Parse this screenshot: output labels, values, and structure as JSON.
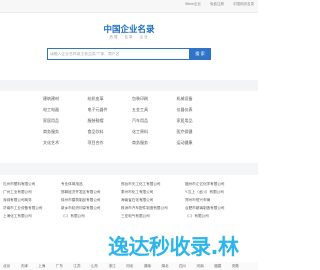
{
  "topbar": {
    "links": [
      "58me企业",
      "免费注册",
      "中国网页名录"
    ]
  },
  "brand": {
    "title": "中国企业名录"
  },
  "hot": {
    "words": [
      "热搜",
      "名录",
      "企业"
    ]
  },
  "search": {
    "placeholder": "请输入企业名称或主营品类/个体、商户名",
    "button": "搜 索"
  },
  "categories": [
    "建筑建材",
    "纺织皮革",
    "包装印刷",
    "机械设备",
    "电工电器",
    "电子元器件",
    "五金工具",
    "仪器仪表",
    "家居用品",
    "服装鞋帽",
    "汽车用品",
    "家居用品",
    "商务服务",
    "食品饮料",
    "化工原料",
    "医疗保健",
    "文化艺术",
    "项目合作",
    "商务服务",
    "运动健康"
  ],
  "enterprises": [
    "礼州市塑料有限公司",
    "专业体育用品",
    "邢台市天工化工有限公司",
    "福州市汇亿化学有限公司",
    "广州工业有限公司",
    "邯郸经济开发区有限公司",
    "泰州市化工有限公司",
    "Y.汉上（龙川）有限公司",
    "深圳有限公司商务",
    "徐州市建筑制品有限公司",
    "海南省石化有限公司",
    "郑州市恒兴车辆",
    "济南市工业设备有限公司",
    "新乡市纺织印染有限公司",
    "株洲市汽车配件制造有限公司",
    "合肥市玻璃制造有限公司",
    "上海化工有限公司",
    "（□）有限公司",
    "三亚电气有限公司",
    "（□）有限公司"
  ],
  "watermark": {
    "text": "逸达秒收录.林"
  },
  "regions": [
    "北京",
    "天津",
    "上海",
    "广东",
    "江苏",
    "山东",
    "浙江",
    "河北",
    "湖南",
    "湖北",
    "四川",
    "河南",
    "福建",
    "安徽"
  ]
}
